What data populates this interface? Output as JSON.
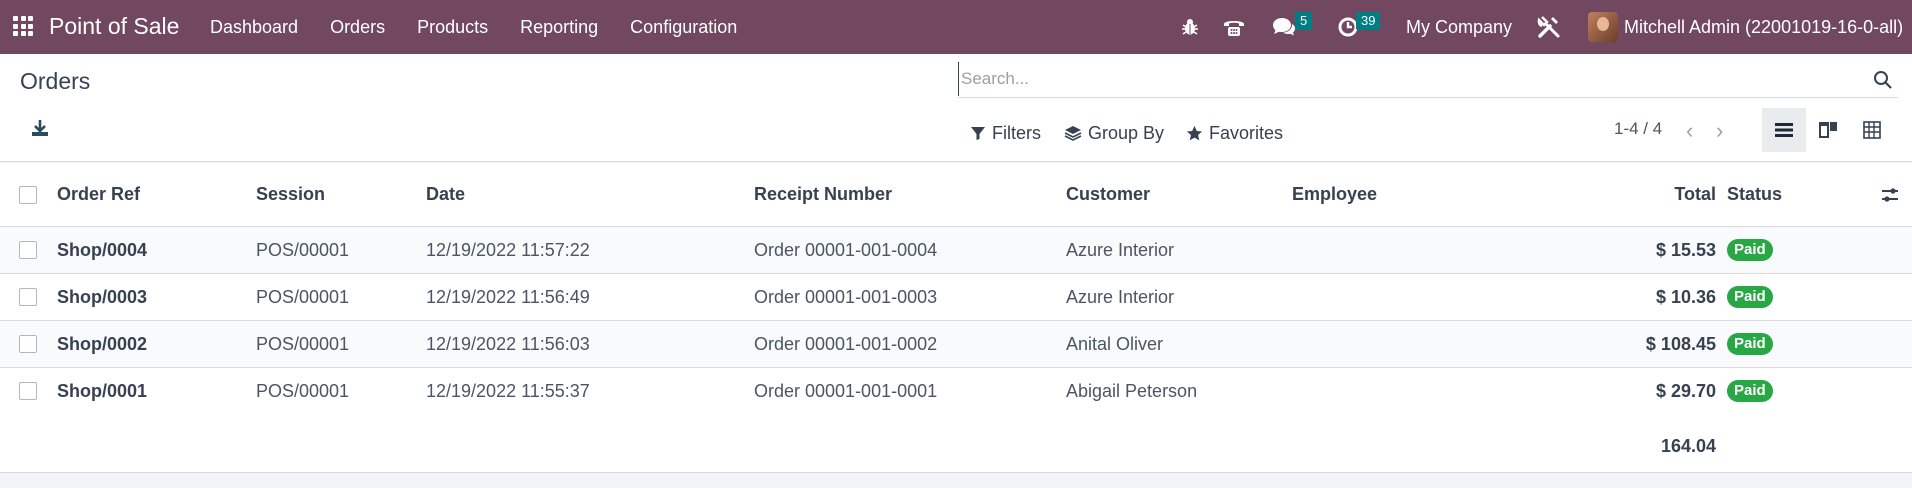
{
  "navbar": {
    "app_name": "Point of Sale",
    "menu": [
      "Dashboard",
      "Orders",
      "Products",
      "Reporting",
      "Configuration"
    ],
    "messages_count": "5",
    "activities_count": "39",
    "company": "My Company",
    "user": "Mitchell Admin (22001019-16-0-all)",
    "colors": {
      "navbar_bg": "#71485f",
      "badge_bg": "#017e84"
    }
  },
  "control": {
    "title": "Orders",
    "search_placeholder": "Search...",
    "filters_label": "Filters",
    "group_by_label": "Group By",
    "favorites_label": "Favorites",
    "pager": "1-4 / 4",
    "views": [
      "list-view",
      "kanban-view",
      "pivot-view"
    ]
  },
  "table": {
    "columns": [
      "Order Ref",
      "Session",
      "Date",
      "Receipt Number",
      "Customer",
      "Employee",
      "Total",
      "Status"
    ],
    "rows": [
      {
        "ref": "Shop/0004",
        "session": "POS/00001",
        "date": "12/19/2022 11:57:22",
        "receipt": "Order 00001-001-0004",
        "customer": "Azure Interior",
        "employee": "",
        "total": "$ 15.53",
        "status": "Paid"
      },
      {
        "ref": "Shop/0003",
        "session": "POS/00001",
        "date": "12/19/2022 11:56:49",
        "receipt": "Order 00001-001-0003",
        "customer": "Azure Interior",
        "employee": "",
        "total": "$ 10.36",
        "status": "Paid"
      },
      {
        "ref": "Shop/0002",
        "session": "POS/00001",
        "date": "12/19/2022 11:56:03",
        "receipt": "Order 00001-001-0002",
        "customer": "Anital Oliver",
        "employee": "",
        "total": "$ 108.45",
        "status": "Paid"
      },
      {
        "ref": "Shop/0001",
        "session": "POS/00001",
        "date": "12/19/2022 11:55:37",
        "receipt": "Order 00001-001-0001",
        "customer": "Abigail Peterson",
        "employee": "",
        "total": "$ 29.70",
        "status": "Paid"
      }
    ],
    "sum_total": "164.04",
    "status_color": "#28a745"
  }
}
